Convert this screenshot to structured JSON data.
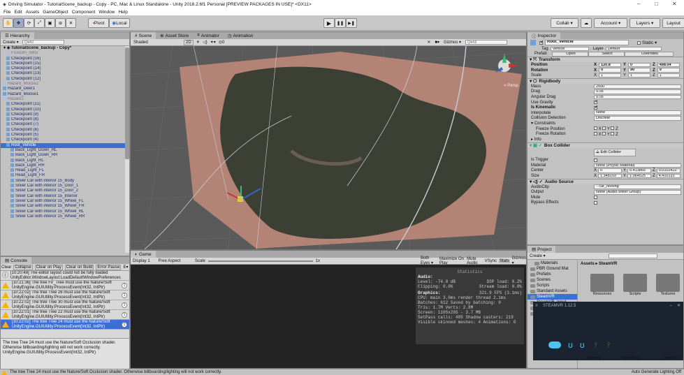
{
  "window": {
    "title": "Driving Simulator - TutorialScene_backup - Copy - PC, Mac & Linux Standalone - Unity 2018.2.6f1 Personal [PREVIEW PACKAGES IN USE]* <DX11>",
    "controls": [
      "–",
      "□",
      "✕"
    ]
  },
  "menu": [
    "File",
    "Edit",
    "Assets",
    "GameObject",
    "Component",
    "Window",
    "Help"
  ],
  "toolbar": {
    "tools": [
      "✋",
      "✥",
      "⟳",
      "⤢",
      "▣",
      "⊛",
      "✕"
    ],
    "pivot": "Pivot",
    "local": "Local",
    "play": "▶",
    "pause": "❚❚",
    "step": "▶❚",
    "collab": "Collab ▾",
    "cloud": "☁",
    "account": "Account ▾",
    "layers": "Layers ▾",
    "layout": "Layout"
  },
  "hierarchy": {
    "tab": "Hierarchy",
    "create": "Create ▾",
    "search_placeholder": "Q▾All",
    "scene": "TutorialScene_backup - Copy*",
    "items": [
      {
        "label": "Frustum_n90x",
        "grey": true,
        "indent": 8
      },
      {
        "label": "Checkpoint (16)",
        "indent": 8
      },
      {
        "label": "Checkpoint (15)",
        "indent": 8
      },
      {
        "label": "Checkpoint (14)",
        "indent": 8
      },
      {
        "label": "Checkpoint (13)",
        "indent": 8
      },
      {
        "label": "Checkpoint (12)",
        "indent": 8
      },
      {
        "label": "Hazard_Moose2",
        "grey": true,
        "indent": 3
      },
      {
        "label": "Hazard_Deer1",
        "indent": 3
      },
      {
        "label": "Hazard_Moose1",
        "indent": 3
      },
      {
        "label": "Hazard1",
        "grey": true,
        "indent": 3
      },
      {
        "label": "Checkpoint (11)",
        "indent": 8
      },
      {
        "label": "Checkpoint (10)",
        "indent": 8
      },
      {
        "label": "Checkpoint (9)",
        "indent": 8
      },
      {
        "label": "Checkpoint (8)",
        "indent": 8
      },
      {
        "label": "Checkpoint (7)",
        "indent": 8
      },
      {
        "label": "Checkpoint (6)",
        "indent": 8
      },
      {
        "label": "Checkpoint (5)",
        "indent": 8
      },
      {
        "label": "Checkpoint (4)",
        "indent": 8
      },
      {
        "label": "Root_Vehicle",
        "selected": true,
        "indent": 8
      },
      {
        "label": "Back_Light_Down_RL",
        "indent": 14
      },
      {
        "label": "Back_Light_Down_RR",
        "indent": 14
      },
      {
        "label": "Back_Light_RL",
        "indent": 14
      },
      {
        "label": "Back_Light_RR",
        "indent": 14
      },
      {
        "label": "Head_Light_FL",
        "indent": 14
      },
      {
        "label": "Head_Light_FR",
        "indent": 14
      },
      {
        "label": "Silver Car with interior 15_Body",
        "indent": 14
      },
      {
        "label": "Silver Car with interior 15_Door_1",
        "indent": 14
      },
      {
        "label": "Silver Car with interior 15_Door_2",
        "indent": 14
      },
      {
        "label": "Silver Car with interior 15_Interior",
        "indent": 14
      },
      {
        "label": "Silver Car with interior 15_Wheel_FL",
        "indent": 14
      },
      {
        "label": "Silver Car with interior 15_Wheel_FR",
        "indent": 14
      },
      {
        "label": "Silver Car with interior 15_Wheel_RL",
        "indent": 14
      },
      {
        "label": "Silver Car with interior 15_Wheel_RR",
        "indent": 14
      }
    ]
  },
  "scene": {
    "tabs": [
      "Scene",
      "Asset Store",
      "Animator",
      "Animation"
    ],
    "shading": "Shaded",
    "mode2d": "2D",
    "gizmos": "Gizmos ▾",
    "search_placeholder": "Q▾All",
    "persp": "< Persp"
  },
  "console": {
    "tab": "Console",
    "buttons": [
      "Clear",
      "Collapse",
      "Clear on Play",
      "Clear on Build",
      "Error Pause",
      "E▾"
    ],
    "entries": [
      {
        "text": "[10:20:48] The editor layout could not be fully loaded\nUnityEditor.WindowLayout:LoadDefaultWindowPreferences",
        "info": true
      },
      {
        "text": "[10:21:36] The tree Fir_Tree must use the Nature/Soft\nUnityEngine.GUIUtility:ProcessEvent(Int32, IntPtr)",
        "count": "1"
      },
      {
        "text": "[10:22:02] The tree Tree 26 must use the Nature/Soft\nUnityEngine.GUIUtility:ProcessEvent(Int32, IntPtr)",
        "count": "1"
      },
      {
        "text": "[10:22:02] The tree Tree 30 must use the Nature/Soft\nUnityEngine.GUIUtility:ProcessEvent(Int32, IntPtr)",
        "count": "1"
      },
      {
        "text": "[10:22:01] The tree Tree 22 must use the Nature/Soft\nUnityEngine.GUIUtility:ProcessEvent(Int32, IntPtr)",
        "count": "1"
      },
      {
        "text": "[10:22:02] The tree Tree 24 must use the Nature/Soft\nUnityEngine.GUIUtility:ProcessEvent(Int32, IntPtr)",
        "count": "1",
        "selected": true
      }
    ],
    "detail": "The tree Tree 24 must use the Nature/Soft Occlusion shader. Otherwise billboarding/lighting will not work correctly.\nUnityEngine.GUIUtility:ProcessEvent(Int32, IntPtr)"
  },
  "game": {
    "tab": "Game",
    "display": "Display 1",
    "aspect": "Free Aspect",
    "scale_label": "Scale",
    "scale_value": "1x",
    "toggles": [
      "Both Eyes ▾",
      "Maximize On Play",
      "Mute Audio",
      "VSync",
      "Stats",
      "Gizmos ▾"
    ],
    "stats": {
      "title": "Statistics",
      "audio_h": "Audio:",
      "audio_l1": "Level: -74.8 dB",
      "audio_r1": "DSP load: 0.2%",
      "audio_l2": "Clipping: 0.0%",
      "audio_r2": "Stream load: 0.0%",
      "graphics_h": "Graphics:",
      "fps": "321.9 FPS (3.1ms)",
      "g1": "CPU: main 3.0ms  render thread 2.1ms",
      "g2": "Batches: 612    Saved by batching: 0",
      "g3": "Tris: 1.7M      Verts: 2.8M",
      "g4": "Screen: 1105x295 - 3.7 MB",
      "g5": "SetPass calls: 485  Shadow casters: 219",
      "g6": "Visible skinned meshes: 4  Animations: 0"
    }
  },
  "inspector": {
    "tab": "Inspector",
    "name": "Root_Vehicle",
    "static": "Static ▾",
    "tag_label": "Tag",
    "tag": "Vehicle",
    "layer_label": "Layer",
    "layer": "Default",
    "prefab_label": "Prefab",
    "prefab_open": "Open",
    "prefab_select": "Select",
    "prefab_overrides": "Overrides",
    "transform": {
      "title": "Transform",
      "position_label": "Position",
      "px": "120.8",
      "py": "0",
      "pz": "498.04",
      "rotation_label": "Rotation",
      "rx": "0",
      "ry": "90",
      "rz": "0",
      "scale_label": "Scale",
      "sx": "1",
      "sy": "1",
      "sz": "1"
    },
    "rigidbody": {
      "title": "Rigidbody",
      "rows": [
        {
          "label": "Mass",
          "value": "2500"
        },
        {
          "label": "Drag",
          "value": "0.05"
        },
        {
          "label": "Angular Drag",
          "value": "0.05"
        }
      ],
      "use_gravity": "Use Gravity",
      "is_kinematic": "Is Kinematic",
      "interpolate_label": "Interpolate",
      "interpolate": "None",
      "collision_label": "Collision Detection",
      "collision": "Discrete",
      "constraints": "Constraints",
      "freeze_pos": "Freeze Position",
      "freeze_rot": "Freeze Rotation",
      "xyz": "X  Y  Z",
      "info": "Info"
    },
    "box_collider": {
      "title": "Box Collider",
      "edit": "Edit Collider",
      "trigger": "Is Trigger",
      "material_label": "Material",
      "material": "None (Physic Material)",
      "center_label": "Center",
      "cx": "0",
      "cy": "0.413865",
      "cz": "0.0102422",
      "size_label": "Size",
      "sx": "1.348193",
      "sy": "1.064525",
      "sz": "4.410131"
    },
    "audio": {
      "title": "Audio Source",
      "clip_label": "AudioClip",
      "clip": "car_revving",
      "output_label": "Output",
      "output": "None (Audio Mixer Group)",
      "mute": "Mute",
      "bypass": "Bypass Effects"
    }
  },
  "project": {
    "tab": "Project",
    "create": "Create ▾",
    "breadcrumb": "Assets ▸ SteamVR",
    "tree": [
      {
        "label": "Materials",
        "indent": 10
      },
      {
        "label": "PBR Ground Mat",
        "indent": 4
      },
      {
        "label": "Prefabs",
        "indent": 4
      },
      {
        "label": "Scenes",
        "indent": 4
      },
      {
        "label": "Scripts",
        "indent": 4
      },
      {
        "label": "Standard Assets",
        "indent": 4
      },
      {
        "label": "SteamVR",
        "indent": 4,
        "selected": true
      },
      {
        "label": "SteamVR_Input",
        "indent": 4
      },
      {
        "label": "Textures",
        "indent": 4
      },
      {
        "label": "Treespackage",
        "indent": 4
      },
      {
        "label": "Bushes",
        "indent": 10
      },
      {
        "label": "Materials",
        "indent": 10
      },
      {
        "label": "Scenes",
        "indent": 10
      },
      {
        "label": "Textures",
        "indent": 10
      },
      {
        "label": "Trees",
        "indent": 10
      },
      {
        "label": "Type1",
        "indent": 16
      },
      {
        "label": "Type2",
        "indent": 16
      },
      {
        "label": "Type3",
        "indent": 16
      }
    ],
    "folders": [
      "Resources",
      "Scripts",
      "Textures"
    ],
    "steamvr_window": {
      "title": "STEAMVR 1.12.5",
      "labels": [
        "SteamVR",
        "SteamVR U...",
        "SteamVR U..."
      ]
    }
  },
  "status": {
    "message": "The tree Tree 24 must use the Nature/Soft Occlusion shader. Otherwise billboarding/lighting will not work correctly.",
    "lighting": "Auto Generate Lighting Off"
  },
  "colors": {
    "accent": "#3b6fd6",
    "warning": "#f5b400",
    "terrain": "#b38476"
  }
}
